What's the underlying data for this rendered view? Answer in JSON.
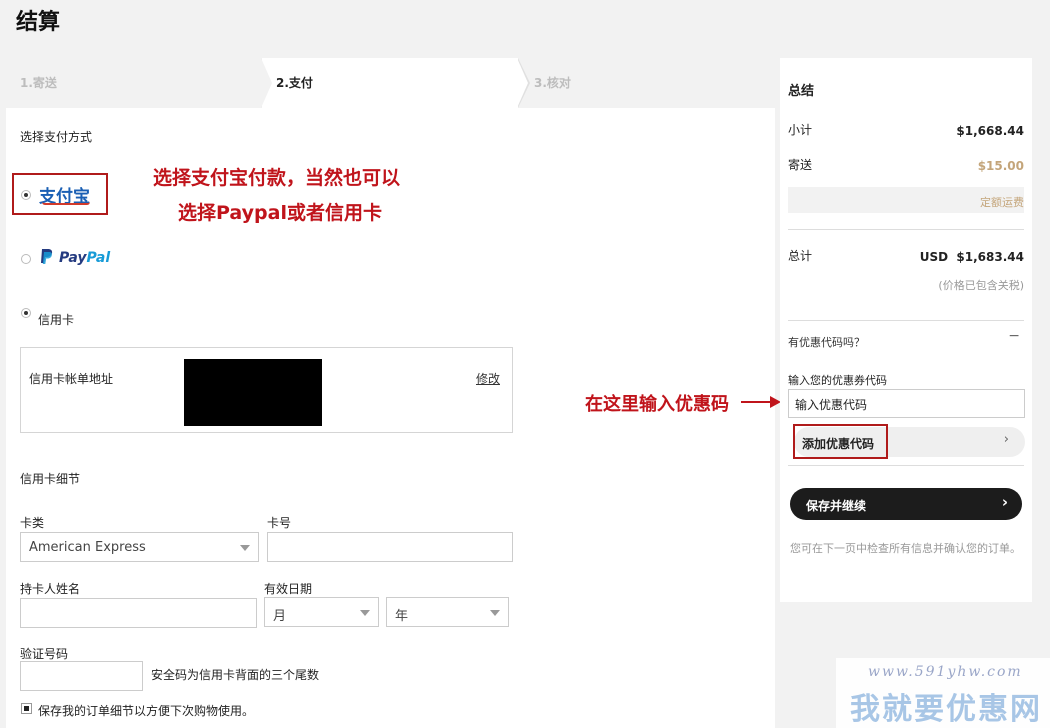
{
  "page": {
    "title": "结算"
  },
  "steps": [
    {
      "label": "1.寄送"
    },
    {
      "label": "2.支付"
    },
    {
      "label": "3.核对"
    }
  ],
  "payment": {
    "heading": "选择支付方式",
    "alipay_logo": "支付宝",
    "paypal_logo_p": "Pay",
    "paypal_logo_pal": "Pal",
    "credit_card_label": "信用卡",
    "billing_label": "信用卡帐单地址",
    "billing_edit": "修改"
  },
  "annotations": {
    "alipay_line1": "选择支付宝付款，当然也可以",
    "alipay_line2": "选择Paypal或者信用卡",
    "coupon_note": "在这里输入优惠码"
  },
  "card": {
    "section_title": "信用卡细节",
    "type_label": "卡类",
    "type_value": "American Express",
    "number_label": "卡号",
    "holder_label": "持卡人姓名",
    "expiry_label": "有效日期",
    "month_value": "月",
    "year_value": "年",
    "cvv_label": "验证号码",
    "cvv_hint": "安全码为信用卡背面的三个尾数",
    "save_label": "保存我的订单细节以方便下次购物使用。"
  },
  "summary": {
    "title": "总结",
    "subtotal_label": "小计",
    "subtotal_value": "$1,668.44",
    "shipping_label": "寄送",
    "shipping_value": "$15.00",
    "shipping_link": "定额运费",
    "total_label": "总计",
    "total_currency": "USD",
    "total_value": "$1,683.44",
    "total_note": "(价格已包含关税)",
    "coupon_toggle": "有优惠代码吗？",
    "coupon_toggle_icon": "−",
    "coupon_label": "输入您的优惠券代码",
    "coupon_placeholder": "输入优惠代码",
    "coupon_button": "添加优惠代码",
    "continue_button": "保存并继续",
    "footer_note": "您可在下一页中检查所有信息并确认您的订单。"
  },
  "watermark": {
    "url": "www.591yhw.com",
    "name": "我就要优惠网"
  },
  "colors": {
    "annotation_red": "#c0141b",
    "shipping_orange": "#c4a57a",
    "paypal_dark": "#253b80",
    "paypal_light": "#179bd7",
    "alipay_blue": "#1a5fb4",
    "button_dark": "#1c1c1c"
  }
}
